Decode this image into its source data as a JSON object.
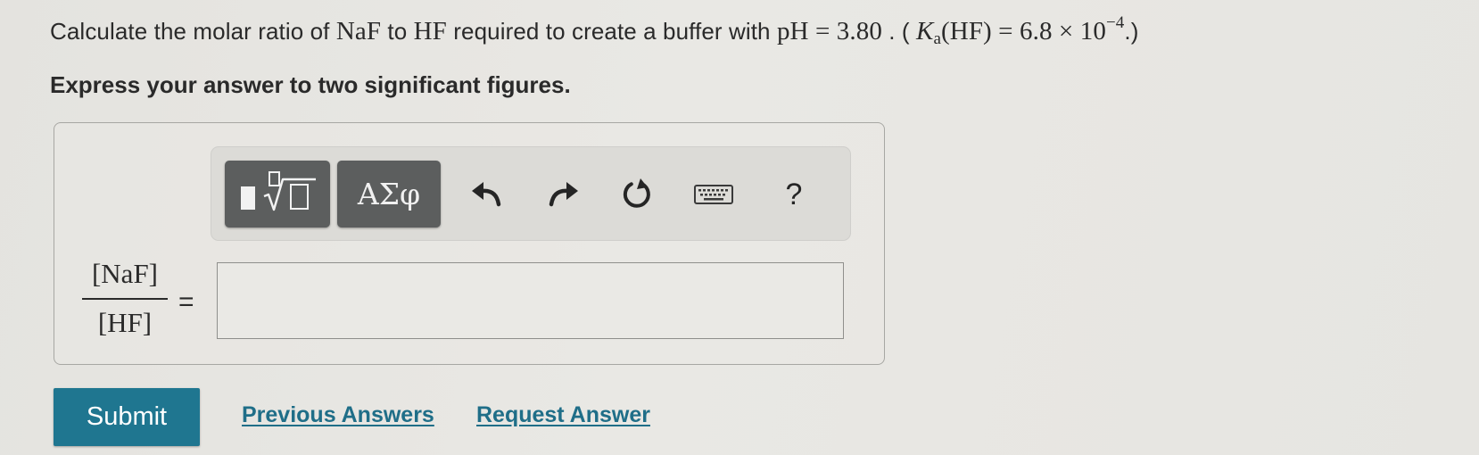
{
  "question": {
    "intro": "Calculate the molar ratio of",
    "species_a": "NaF",
    "connector": "to",
    "species_b": "HF",
    "middle": "required to create a buffer with",
    "ph_symbol": "pH",
    "equals_sign": "=",
    "ph_value": "3.80",
    "separator": ". (",
    "ka_symbol": "K",
    "ka_subscript": "a",
    "ka_species": "(HF)",
    "ka_mantissa": "6.8",
    "times_sign": "×",
    "ka_base": "10",
    "ka_exponent": "−4",
    "close": ".)"
  },
  "instruction": "Express your answer to two significant figures.",
  "toolbar": {
    "templates_icon": "templates-radical-icon",
    "symbols_label": "ΑΣφ",
    "undo_icon": "undo-icon",
    "redo_icon": "redo-icon",
    "reset_icon": "reset-icon",
    "keyboard_icon": "keyboard-icon",
    "help_label": "?",
    "button_color": "#5c5e5e"
  },
  "answer": {
    "numerator": "[NaF]",
    "denominator": "[HF]",
    "equals": "=",
    "value": ""
  },
  "actions": {
    "submit_label": "Submit",
    "submit_color": "#1f7690",
    "previous_answers_label": "Previous Answers",
    "request_answer_label": "Request Answer",
    "link_color": "#1f6e88"
  }
}
